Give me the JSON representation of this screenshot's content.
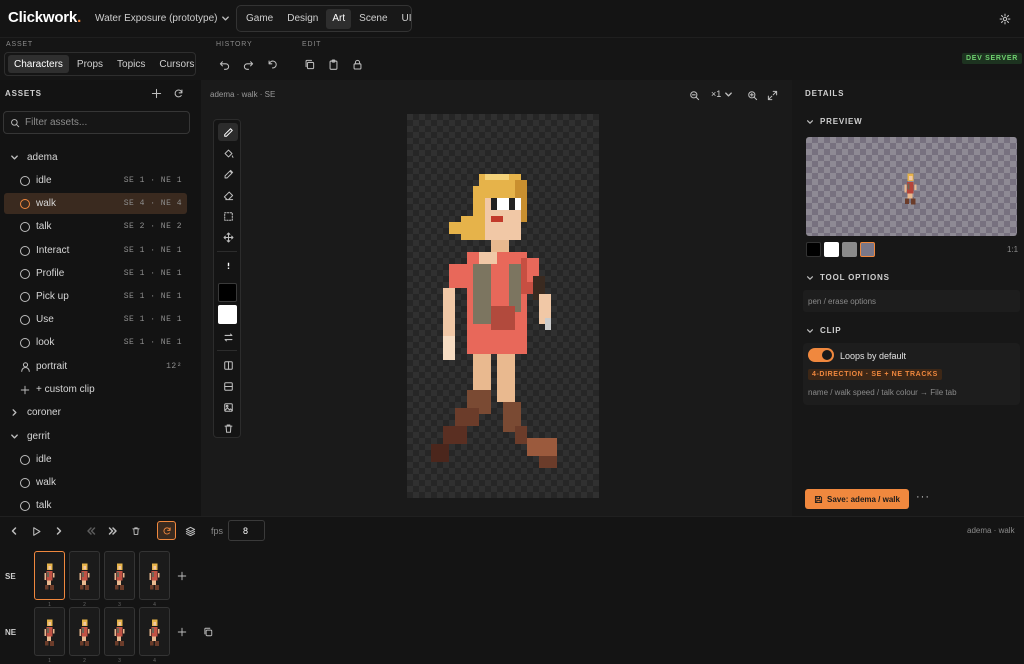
{
  "app": {
    "name": "Clickwork",
    "project": "Water Exposure (prototype)",
    "modes": [
      "Game",
      "Design",
      "Art",
      "Scene",
      "UI"
    ],
    "active_mode": "Art"
  },
  "toolbar": {
    "asset_section": "ASSET",
    "history_section": "HISTORY",
    "edit_section": "EDIT",
    "asset_tabs": [
      "Characters",
      "Props",
      "Topics",
      "Cursors"
    ],
    "active_tab": "Characters",
    "dev_badge": "DEV SERVER"
  },
  "assets": {
    "heading": "ASSETS",
    "filter_placeholder": "Filter assets...",
    "tree": [
      {
        "type": "group",
        "label": "adema",
        "expanded": true
      },
      {
        "type": "clip",
        "label": "idle",
        "meta": "SE 1 · NE 1"
      },
      {
        "type": "clip",
        "label": "walk",
        "meta": "SE 4 · NE 4",
        "selected": true
      },
      {
        "type": "clip",
        "label": "talk",
        "meta": "SE 2 · NE 2"
      },
      {
        "type": "clip",
        "label": "Interact",
        "meta": "SE 1 · NE 1"
      },
      {
        "type": "clip",
        "label": "Profile",
        "meta": "SE 1 · NE 1"
      },
      {
        "type": "clip",
        "label": "Pick up",
        "meta": "SE 1 · NE 1"
      },
      {
        "type": "clip",
        "label": "Use",
        "meta": "SE 1 · NE 1"
      },
      {
        "type": "clip",
        "label": "look",
        "meta": "SE 1 · NE 1"
      },
      {
        "type": "portrait",
        "label": "portrait",
        "meta": "12²"
      },
      {
        "type": "add",
        "label": "+ custom clip"
      },
      {
        "type": "group",
        "label": "coroner",
        "expanded": false
      },
      {
        "type": "group",
        "label": "gerrit",
        "expanded": true
      },
      {
        "type": "clip",
        "label": "idle"
      },
      {
        "type": "clip",
        "label": "walk"
      },
      {
        "type": "clip",
        "label": "talk"
      }
    ]
  },
  "canvas": {
    "breadcrumb": "adema · walk · SE",
    "zoom": "×1"
  },
  "colors": {
    "accent": "#f0883e",
    "primary": "#000000",
    "secondary": "#ffffff"
  },
  "details": {
    "heading": "DETAILS",
    "preview_heading": "PREVIEW",
    "preview_ratio": "1:1",
    "tool_options_heading": "TOOL OPTIONS",
    "tool_options_text": "pen / erase options",
    "clip_heading": "CLIP",
    "loops_label": "Loops by default",
    "loops_on": true,
    "clip_badge": "4-DIRECTION · SE + NE TRACKS",
    "clip_hint": "name / walk speed / talk colour → File tab",
    "save_label": "Save: adema / walk"
  },
  "timeline": {
    "fps_label": "fps",
    "fps": "8",
    "status": "adema · walk",
    "tracks": [
      {
        "label": "SE",
        "frames": [
          "1",
          "2",
          "3",
          "4"
        ],
        "selected": 0
      },
      {
        "label": "NE",
        "frames": [
          "1",
          "2",
          "3",
          "4"
        ]
      }
    ]
  }
}
